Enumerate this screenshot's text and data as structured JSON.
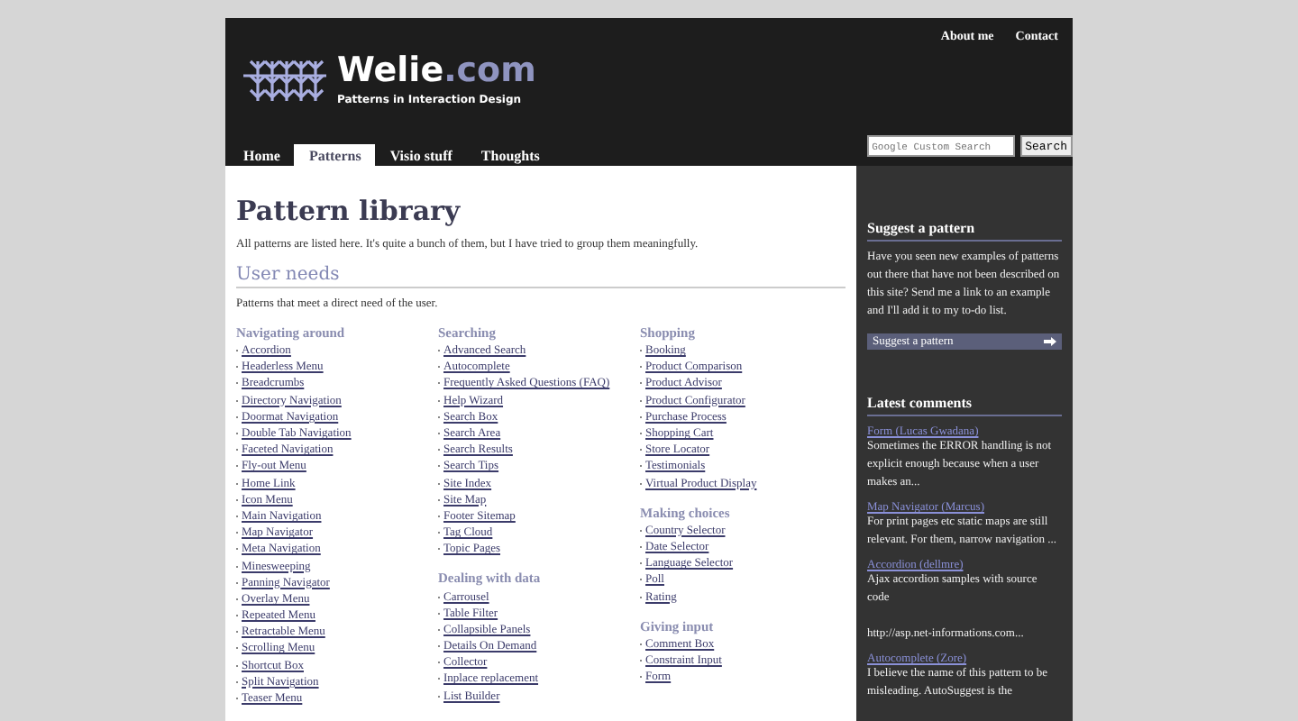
{
  "header": {
    "logo": {
      "name": "Welie",
      "suffix": ".com",
      "tagline": "Patterns in Interaction Design"
    },
    "top_links": [
      "About me",
      "Contact"
    ],
    "tabs": [
      {
        "label": "Home",
        "selected": false
      },
      {
        "label": "Patterns",
        "selected": true
      },
      {
        "label": "Visio stuff",
        "selected": false
      },
      {
        "label": "Thoughts",
        "selected": false
      }
    ],
    "search": {
      "placeholder": "Google Custom Search",
      "button": "Search"
    }
  },
  "main": {
    "title": "Pattern library",
    "intro": "All patterns are listed here. It's quite a bunch of them, but I have tried to group them meaningfully.",
    "section": {
      "title": "User needs",
      "description": "Patterns that meet a direct need of the user.",
      "columns": [
        [
          {
            "title": "Navigating around",
            "items": [
              "Accordion",
              "Headerless Menu",
              "Breadcrumbs",
              "Directory Navigation",
              "Doormat Navigation",
              "Double Tab Navigation",
              "Faceted Navigation",
              "Fly-out Menu",
              "Home Link",
              "Icon Menu",
              "Main Navigation",
              "Map Navigator",
              "Meta Navigation",
              "Minesweeping",
              "Panning Navigator",
              "Overlay Menu",
              "Repeated Menu",
              "Retractable Menu",
              "Scrolling Menu",
              "Shortcut Box",
              "Split Navigation",
              "Teaser Menu"
            ]
          }
        ],
        [
          {
            "title": "Searching",
            "items": [
              "Advanced Search",
              "Autocomplete",
              "Frequently Asked Questions (FAQ)",
              "Help Wizard",
              "Search Box",
              "Search Area",
              "Search Results",
              "Search Tips",
              "Site Index",
              "Site Map",
              "Footer Sitemap",
              "Tag Cloud",
              "Topic Pages"
            ]
          },
          {
            "title": "Dealing with data",
            "items": [
              "Carrousel",
              "Table Filter",
              "Collapsible Panels",
              "Details On Demand",
              "Collector",
              "Inplace replacement",
              "List Builder"
            ]
          }
        ],
        [
          {
            "title": "Shopping",
            "items": [
              "Booking",
              "Product Comparison",
              "Product Advisor",
              "Product Configurator",
              "Purchase Process",
              "Shopping Cart",
              "Store Locator",
              "Testimonials",
              "Virtual Product Display"
            ]
          },
          {
            "title": "Making choices",
            "items": [
              "Country Selector",
              "Date Selector",
              "Language Selector",
              "Poll",
              "Rating"
            ]
          },
          {
            "title": "Giving input",
            "items": [
              "Comment Box",
              "Constraint Input",
              "Form"
            ]
          }
        ]
      ]
    }
  },
  "sidebar": {
    "suggest": {
      "title": "Suggest a pattern",
      "text": "Have you seen new examples of patterns out there that have not been described on this site? Send me a link to an example and I'll add it to my to-do list.",
      "button": "Suggest a pattern"
    },
    "comments": {
      "title": "Latest comments",
      "items": [
        {
          "link": "Form (Lucas Gwadana)",
          "text": [
            "Sometimes the ERROR handling is not explicit enough because when a user makes an..."
          ]
        },
        {
          "link": "Map Navigator (Marcus)",
          "text": [
            "For print pages etc static maps are still relevant. For them, narrow navigation ..."
          ]
        },
        {
          "link": "Accordion (dellmre)",
          "text": [
            "Ajax accordion samples with source code",
            "http://asp.net-informations.com..."
          ]
        },
        {
          "link": "Autocomplete (Zore)",
          "text": [
            "I believe the name of this pattern to be misleading. AutoSuggest is the"
          ]
        }
      ]
    }
  }
}
